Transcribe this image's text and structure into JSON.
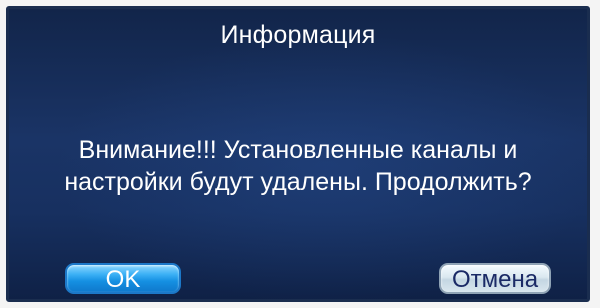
{
  "dialog": {
    "title": "Информация",
    "message_line1": "Внимание!!! Установленные каналы и",
    "message_line2": "настройки будут удалены. Продолжить?",
    "ok_label": "OK",
    "cancel_label": "Отмена"
  },
  "colors": {
    "dialog_background": "#1a3466",
    "ok_button": "#1590e2",
    "cancel_button": "#dbe8f0",
    "text": "#ffffff"
  }
}
